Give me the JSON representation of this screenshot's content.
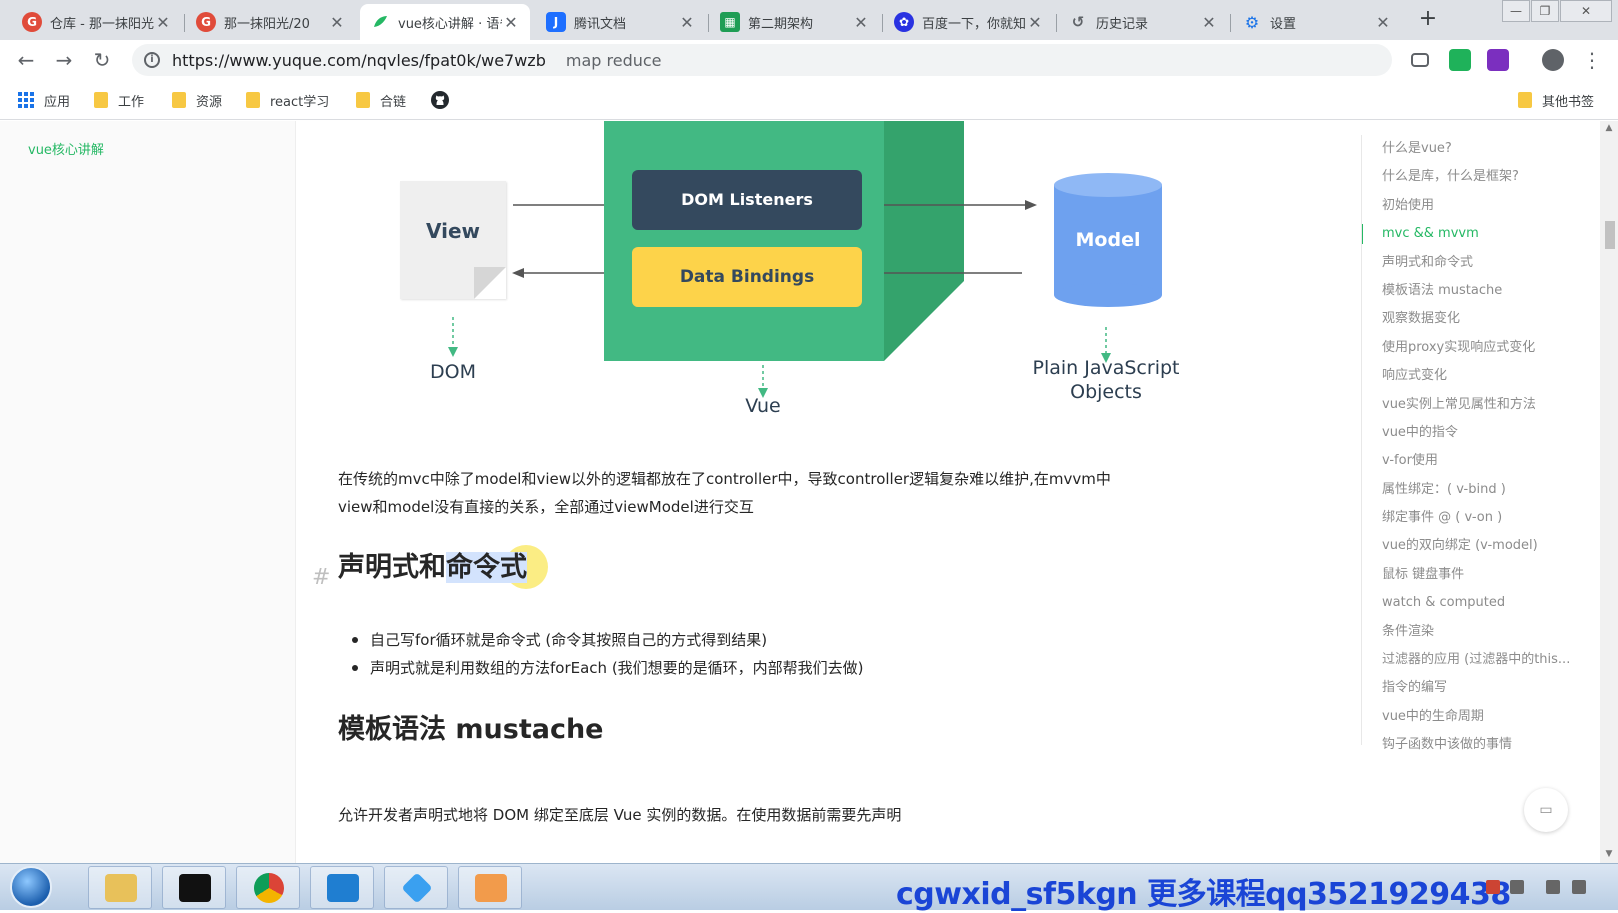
{
  "browser": {
    "tabs": [
      {
        "title": "仓库 - 那一抹阳光",
        "icon": "yuque-red-icon",
        "color": "#e04b3a"
      },
      {
        "title": "那一抹阳光/20",
        "icon": "yuque-red-icon",
        "color": "#e04b3a"
      },
      {
        "title": "vue核心讲解 · 语雀",
        "icon": "yuque-green-icon",
        "color": "#25b864",
        "active": true
      },
      {
        "title": "腾讯文档",
        "icon": "tencent-docs-icon",
        "color": "#1e6fff"
      },
      {
        "title": "第二期架构",
        "icon": "sheet-icon",
        "color": "#1f9d55"
      },
      {
        "title": "百度一下，你就知道",
        "icon": "baidu-paw-icon",
        "color": "#2932e1"
      },
      {
        "title": "历史记录",
        "icon": "history-icon",
        "color": "#5f6368"
      },
      {
        "title": "设置",
        "icon": "gear-icon",
        "color": "#1a73e8"
      }
    ],
    "new_tab": "+",
    "url": "https://www.yuque.com/nqvles/fpat0k/we7wzb",
    "url_suffix": "map reduce",
    "bookmarks": [
      {
        "label": "应用",
        "icon": "apps-grid-icon"
      },
      {
        "label": "工作",
        "icon": "folder-icon"
      },
      {
        "label": "资源",
        "icon": "folder-icon"
      },
      {
        "label": "react学习",
        "icon": "folder-icon"
      },
      {
        "label": "合链",
        "icon": "folder-icon"
      },
      {
        "label": "",
        "icon": "github-icon"
      }
    ],
    "other_bookmarks": "其他书签"
  },
  "left_nav": {
    "doc_link": "vue核心讲解"
  },
  "diagram": {
    "view": "View",
    "dom_listeners": "DOM Listeners",
    "data_bindings": "Data Bindings",
    "model": "Model",
    "dom": "DOM",
    "vue": "Vue",
    "plain_js_line1": "Plain JavaScript",
    "plain_js_line2": "Objects"
  },
  "article": {
    "para1_line1": "在传统的mvc中除了model和view以外的逻辑都放在了controller中，导致controller逻辑复杂难以维护,在mvvm中",
    "para1_line2": "view和model没有直接的关系，全部通过viewModel进行交互",
    "h_declarative_a": "声明式和",
    "h_declarative_b": "命令式",
    "bullets": [
      "自己写for循环就是命令式 (命令其按照自己的方式得到结果)",
      "声明式就是利用数组的方法forEach (我们想要的是循环，内部帮我们去做)"
    ],
    "h_template": "模板语法 mustache",
    "para2": "允许开发者声明式地将 DOM 绑定至底层 Vue 实例的数据。在使用数据前需要先声明"
  },
  "toc": [
    "什么是vue?",
    "什么是库，什么是框架?",
    "初始使用",
    "mvc && mvvm",
    "声明式和命令式",
    "模板语法 mustache",
    "观察数据变化",
    "使用proxy实现响应式变化",
    "响应式变化",
    "vue实例上常见属性和方法",
    "vue中的指令",
    "v-for使用",
    "属性绑定：( v-bind )",
    "绑定事件 @ ( v-on )",
    "vue的双向绑定 (v-model)",
    "鼠标 键盘事件",
    "watch & computed",
    "条件渲染",
    "过滤器的应用 (过滤器中的this...",
    "指令的编写",
    "vue中的生命周期",
    "钩子函数中该做的事情"
  ],
  "toc_active_index": 3,
  "taskbar": {
    "watermark": "cgwxid_sf5kgn 更多课程qq3521929438",
    "apps": [
      "file-explorer-icon",
      "terminal-icon",
      "chrome-icon",
      "vscode-icon",
      "app-diamond-icon",
      "sublime-icon"
    ]
  },
  "colors": {
    "vue_green": "#42b983",
    "vue_dark": "#34495e",
    "binding_yellow": "#fdd34a",
    "model_blue": "#6ea1ef",
    "accent_green": "#25b864"
  }
}
